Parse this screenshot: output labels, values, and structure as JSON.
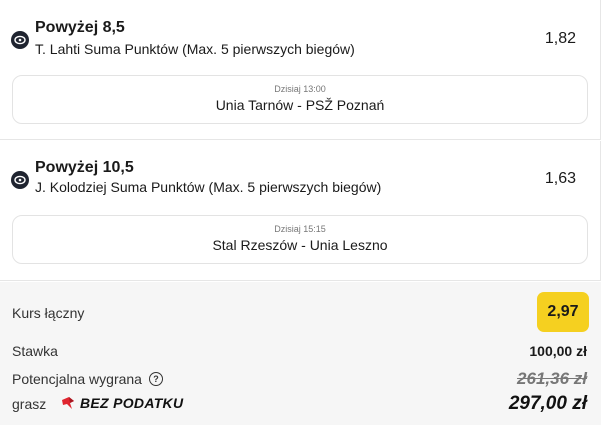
{
  "bets": [
    {
      "market": "Powyżej 8,5",
      "selection": "T. Lahti Suma Punktów (Max. 5 pierwszych biegów)",
      "odds": "1,82",
      "event_time": "Dzisiaj 13:00",
      "event_name": "Unia Tarnów - PSŽ Poznań",
      "icon": "speedway-icon"
    },
    {
      "market": "Powyżej 10,5",
      "selection": "J. Kolodziej Suma Punktów (Max. 5 pierwszych biegów)",
      "odds": "1,63",
      "event_time": "Dzisiaj 15:15",
      "event_name": "Stal Rzeszów - Unia Leszno",
      "icon": "speedway-icon"
    }
  ],
  "summary": {
    "total_odds_label": "Kurs łączny",
    "total_odds": "2,97",
    "stake_label": "Stawka",
    "stake": "100,00 zł",
    "potential_win_label": "Potencjalna wygrana",
    "help_icon": "?",
    "potential_win_old": "261,36 zł",
    "grasz_label": "grasz",
    "brand_text": "BEZ PODATKU",
    "potential_win": "297,00 zł"
  },
  "colors": {
    "accent": "#f5d020",
    "brand_red": "#e0252f",
    "summary_bg": "#f6f6f6"
  }
}
